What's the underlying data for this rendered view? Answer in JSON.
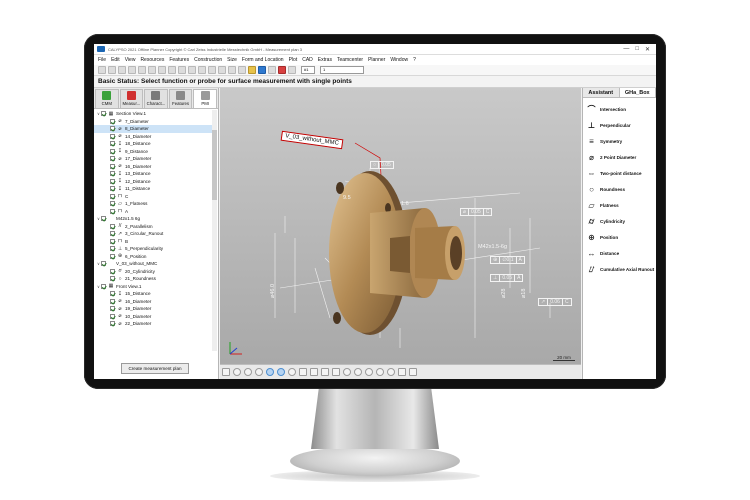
{
  "window": {
    "title": "CALYPSO 2021 Offline Planner Copyright © Carl Zeiss Industrielle Messtechnik GmbH - Measurement plan 3",
    "controls": [
      "—",
      "□",
      "✕"
    ]
  },
  "menu": [
    "File",
    "Edit",
    "View",
    "Resources",
    "Features",
    "Construction",
    "Size",
    "Form and Location",
    "Plot",
    "CAD",
    "Extras",
    "Teamcenter",
    "Planner",
    "Window",
    "?"
  ],
  "toolbar": {
    "field_1": "#1",
    "field_2": "1"
  },
  "status": "Basic Status: Select function or probe for surface measurement with single points",
  "left_tabs": [
    {
      "label": "CMM",
      "color": "#3aa13a"
    },
    {
      "label": "Measur...",
      "color": "#d03030"
    },
    {
      "label": "Charact...",
      "color": "#7a7a7a"
    },
    {
      "label": "Features",
      "color": "#8a8a8a"
    },
    {
      "label": "PMI",
      "color": "#9a9a9a"
    }
  ],
  "tree": [
    {
      "level": 0,
      "exp": "∨",
      "sym": "▦",
      "label": "Section View.1"
    },
    {
      "level": 1,
      "sym": "⌀",
      "label": "7_Diameter"
    },
    {
      "level": 1,
      "sym": "⌀",
      "label": "8_Diameter",
      "selected": true
    },
    {
      "level": 1,
      "sym": "⌀",
      "label": "14_Diameter"
    },
    {
      "level": 1,
      "sym": "↧",
      "label": "18_Distance"
    },
    {
      "level": 1,
      "sym": "↧",
      "label": "9_Distance"
    },
    {
      "level": 1,
      "sym": "⌀",
      "label": "17_Diameter"
    },
    {
      "level": 1,
      "sym": "⌀",
      "label": "16_Diameter"
    },
    {
      "level": 1,
      "sym": "↧",
      "label": "13_Distance"
    },
    {
      "level": 1,
      "sym": "↧",
      "label": "12_Distance"
    },
    {
      "level": 1,
      "sym": "↧",
      "label": "11_Distance"
    },
    {
      "level": 1,
      "sym": "⊓",
      "label": "C"
    },
    {
      "level": 1,
      "sym": "▱",
      "label": "1_Flatness"
    },
    {
      "level": 1,
      "sym": "⊓",
      "label": "A"
    },
    {
      "level": 0,
      "exp": "∨",
      "sym": "",
      "label": "M42x1.5 6g"
    },
    {
      "level": 1,
      "sym": "//",
      "label": "2_Parallelism"
    },
    {
      "level": 1,
      "sym": "↗",
      "label": "3_Circular_Runout"
    },
    {
      "level": 1,
      "sym": "⊓",
      "label": "B"
    },
    {
      "level": 1,
      "sym": "⊥",
      "label": "5_Perpendicularity"
    },
    {
      "level": 1,
      "sym": "⊕",
      "label": "6_Position"
    },
    {
      "level": 0,
      "exp": "∨",
      "sym": "",
      "label": "V_03_without_MMC"
    },
    {
      "level": 1,
      "sym": "⌭",
      "label": "20_Cylindricity"
    },
    {
      "level": 1,
      "sym": "○",
      "label": "21_Roundness"
    },
    {
      "level": 0,
      "exp": "∨",
      "sym": "▦",
      "label": "Front View.1"
    },
    {
      "level": 1,
      "sym": "↧",
      "label": "15_Distance"
    },
    {
      "level": 1,
      "sym": "⌀",
      "label": "16_Diameter"
    },
    {
      "level": 1,
      "sym": "⌀",
      "label": "19_Diameter"
    },
    {
      "level": 1,
      "sym": "⌀",
      "label": "10_Diameter"
    },
    {
      "level": 1,
      "sym": "⌀",
      "label": "22_Diameter"
    }
  ],
  "create_button": "Create measurement plan",
  "viewport": {
    "callout": "V_03_without_MMC",
    "gdt_1": [
      "○",
      "0.05"
    ],
    "gdt_2": [
      "⊕",
      "∅0.1",
      "A"
    ],
    "gdt_3": [
      "⊥",
      "0.05",
      "A"
    ],
    "gdt_4": [
      "⌀",
      "0.05",
      "C"
    ],
    "gdt_5": [
      "↗",
      "0.06",
      "C"
    ],
    "dim_1": "9.5",
    "dim_2": "1.6",
    "dim_3": "M42x1.5-6g",
    "dim_4": "⌀46.0",
    "dim_5": "⌀28",
    "dim_6": "⌀18",
    "scale": "20 mm"
  },
  "right_tabs": [
    "Assistant",
    "GHa_Box"
  ],
  "right_items": [
    {
      "icon": "⌒",
      "label": "Intersection"
    },
    {
      "icon": "⊥",
      "label": "Perpendicular"
    },
    {
      "icon": "≡",
      "label": "Symmetry"
    },
    {
      "icon": "⌀",
      "label": "2 Point Diameter"
    },
    {
      "icon": "⇔",
      "label": "Two-point distance"
    },
    {
      "icon": "○",
      "label": "Roundness"
    },
    {
      "icon": "▱",
      "label": "Flatness"
    },
    {
      "icon": "⌭",
      "label": "Cylindricity"
    },
    {
      "icon": "⊕",
      "label": "Position"
    },
    {
      "icon": "↔",
      "label": "Distance"
    },
    {
      "icon": "⌰",
      "label": "Cumulative Axial Runout"
    }
  ]
}
